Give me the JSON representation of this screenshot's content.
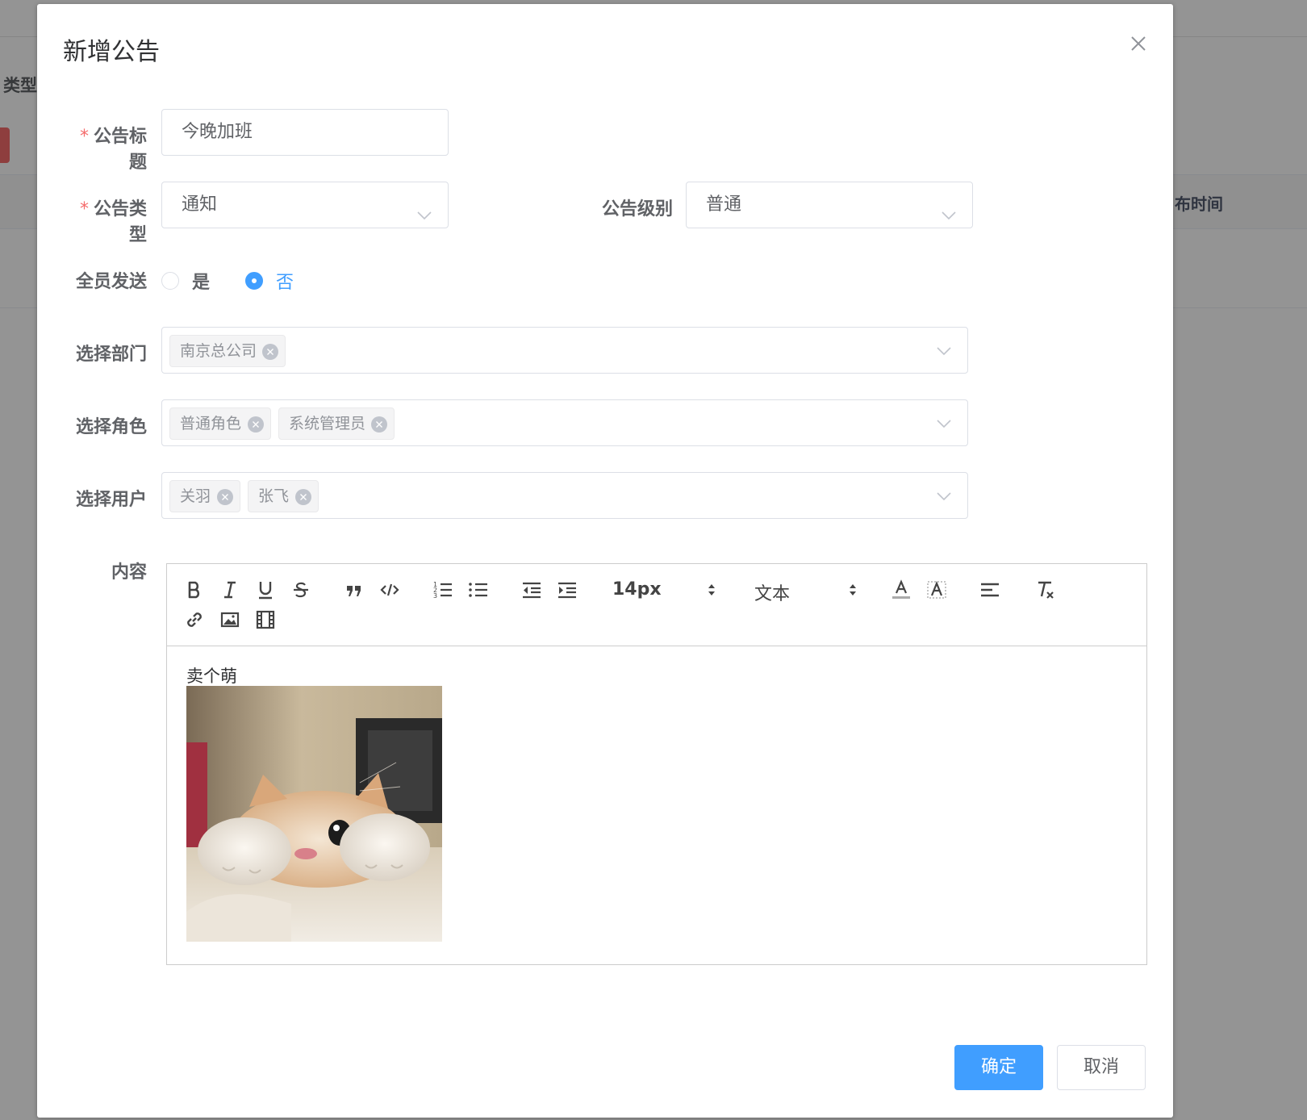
{
  "background": {
    "type_label": "类型",
    "column_label": "布时间"
  },
  "dialog": {
    "title": "新增公告",
    "close_icon": "close-icon"
  },
  "form": {
    "title_label": "公告标题",
    "title_value": "今晚加班",
    "type_label": "公告类型",
    "type_value": "通知",
    "level_label": "公告级别",
    "level_value": "普通",
    "send_all_label": "全员发送",
    "send_all_options": [
      "是",
      "否"
    ],
    "send_all_selected": "否",
    "dept_label": "选择部门",
    "dept_tags": [
      "南京总公司"
    ],
    "role_label": "选择角色",
    "role_tags": [
      "普通角色",
      "系统管理员"
    ],
    "user_label": "选择用户",
    "user_tags": [
      "关羽",
      "张飞"
    ],
    "content_label": "内容",
    "required_mark": "*"
  },
  "editor": {
    "toolbar_icons": [
      "bold-icon",
      "italic-icon",
      "underline-icon",
      "strike-icon",
      "blockquote-icon",
      "code-block-icon",
      "ordered-list-icon",
      "bullet-list-icon",
      "outdent-icon",
      "indent-icon",
      "font-color-icon",
      "background-color-icon",
      "align-icon",
      "clear-format-icon",
      "link-icon",
      "image-icon",
      "video-icon"
    ],
    "size_picker": "14px",
    "header_picker": "文本",
    "content_text": "卖个萌",
    "content_image": "cat-photo"
  },
  "footer": {
    "confirm_label": "确定",
    "cancel_label": "取消"
  },
  "colors": {
    "primary": "#409eff",
    "required": "#f56c6c",
    "border": "#dcdfe6"
  }
}
